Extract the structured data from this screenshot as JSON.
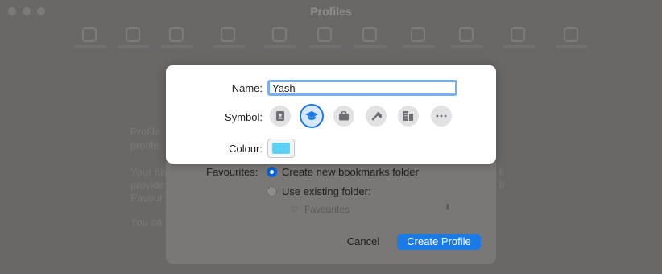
{
  "window": {
    "title": "Profiles"
  },
  "toolbar": {
    "items": [
      "general",
      "tabs",
      "autofill",
      "passwords",
      "search",
      "security",
      "privacy",
      "websites",
      "profiles",
      "extensions",
      "advanced",
      "developer"
    ]
  },
  "background_text": {
    "line1": "Profile",
    "line2": "profile",
    "line3": "Your his",
    "line4": "provide",
    "line5": "Favour",
    "line6": "You ca",
    "right1": "il",
    "right2": "lr"
  },
  "sheet": {
    "favourites_label": "Favourites:",
    "option_new": "Create new bookmarks folder",
    "option_existing": "Use existing folder:",
    "existing_folder_value": "Favourites",
    "cancel_label": "Cancel",
    "create_label": "Create Profile"
  },
  "panel": {
    "name_label": "Name:",
    "name_value": "Yash",
    "symbol_label": "Symbol:",
    "symbols": [
      "badge-icon",
      "graduation-cap-icon",
      "briefcase-icon",
      "hammer-icon",
      "building-icon",
      "more-icon"
    ],
    "selected_symbol": "graduation-cap-icon",
    "colour_label": "Colour:",
    "colour_value": "#5ed1f7"
  },
  "colors": {
    "accent": "#1a7ae6"
  }
}
